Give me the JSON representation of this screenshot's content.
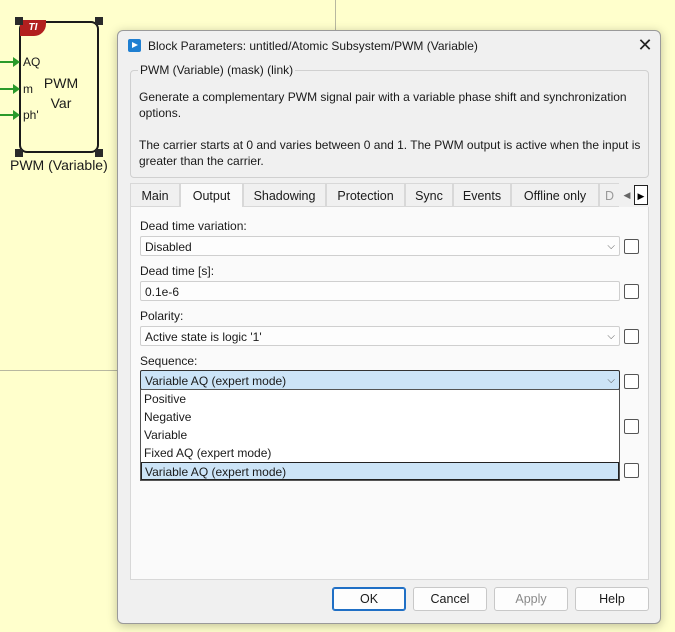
{
  "canvas": {
    "block": {
      "badge": "TI",
      "title_line1": "PWM",
      "title_line2": "Var",
      "ports": [
        "AQ",
        "m",
        "ph'"
      ],
      "caption": "PWM (Variable)"
    }
  },
  "dialog": {
    "title": "Block Parameters: untitled/Atomic Subsystem/PWM (Variable)",
    "group_title": "PWM (Variable) (mask) (link)",
    "description_1": "Generate a complementary PWM signal pair with a variable phase shift and synchronization",
    "description_2": "options.",
    "description_3": "The carrier starts at 0 and varies between 0 and 1. The PWM output is active when the input is",
    "description_4": "greater than the carrier.",
    "tabs": [
      "Main",
      "Output",
      "Shadowing",
      "Protection",
      "Sync",
      "Events",
      "Offline only",
      "D"
    ],
    "active_tab": "Output",
    "params": {
      "dead_time_variation": {
        "label": "Dead time variation:",
        "value": "Disabled"
      },
      "dead_time": {
        "label": "Dead time [s]:",
        "value": "0.1e-6"
      },
      "polarity": {
        "label": "Polarity:",
        "value": "Active state is logic '1'"
      },
      "sequence": {
        "label": "Sequence:",
        "value": "Variable AQ (expert mode)"
      }
    },
    "sequence_options": [
      "Positive",
      "Negative",
      "Variable",
      "Fixed AQ (expert mode)",
      "Variable AQ (expert mode)"
    ],
    "sequence_selected_index": 4,
    "buttons": {
      "ok": "OK",
      "cancel": "Cancel",
      "apply": "Apply",
      "help": "Help"
    },
    "icons": {
      "close": "✕",
      "chevron": "⌵",
      "tab_left": "◀",
      "tab_right": "▶"
    }
  }
}
